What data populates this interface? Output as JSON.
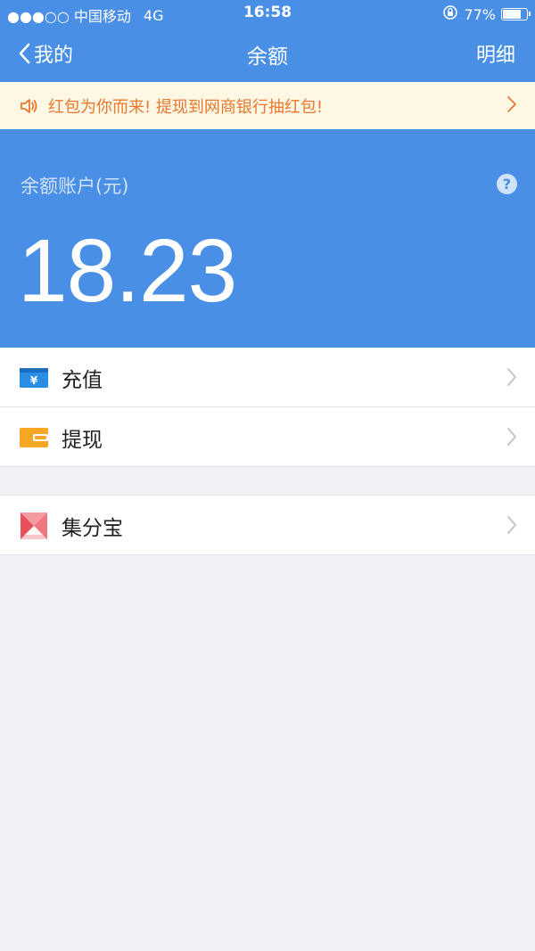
{
  "status_bar": {
    "carrier": "●●●○○ 中国移动",
    "network": "4G",
    "time": "16:58",
    "battery_percent": "77%",
    "battery_level": 0.77
  },
  "nav": {
    "back_label": "我的",
    "title": "余额",
    "right_label": "明细"
  },
  "notice": {
    "text": "红包为你而来! 提现到网商银行抽红包!"
  },
  "balance": {
    "label": "余额账户(元)",
    "amount": "18.23",
    "help": "?"
  },
  "menu": {
    "recharge": "充值",
    "withdraw": "提现",
    "points": "集分宝"
  },
  "colors": {
    "primary": "#4a8fe6",
    "notice_text": "#e8782f",
    "notice_bg": "#fdf7e3",
    "recharge_icon": "#2b8ee4",
    "withdraw_icon": "#f5a623",
    "points_icon": "#e8505b"
  }
}
